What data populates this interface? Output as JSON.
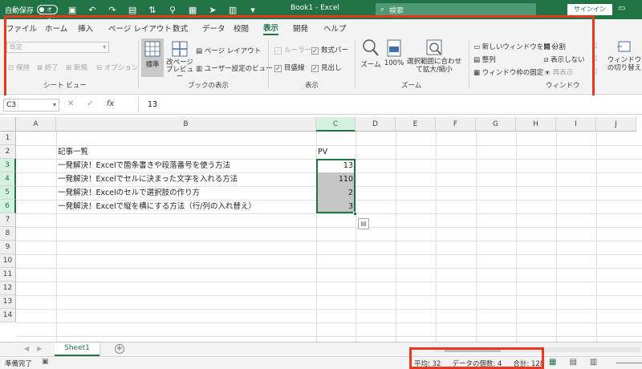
{
  "titlebar": {
    "autosave_label": "自動保存",
    "autosave_state": "オフ",
    "title": "Book1  -  Excel",
    "search_placeholder": "検索",
    "signin": "サインイン"
  },
  "tabs": [
    "ファイル",
    "ホーム",
    "挿入",
    "ページ レイアウト",
    "数式",
    "データ",
    "校閲",
    "表示",
    "開発",
    "ヘルプ"
  ],
  "active_tab": "表示",
  "ribbon": {
    "sheetview": {
      "dropdown": "既定",
      "keep": "保持",
      "exit": "終了",
      "new": "新規",
      "options": "オプション",
      "label": "シート ビュー"
    },
    "bookview": {
      "normal": "標準",
      "pagebreak": "改ページ プレビュー",
      "pagelayout": "ページ レイアウト",
      "custom": "ユーザー設定のビュー",
      "label": "ブックの表示"
    },
    "show": {
      "ruler": "ルーラー",
      "formulabar": "数式バー",
      "gridlines": "目盛線",
      "headings": "見出し",
      "label": "表示"
    },
    "zoom": {
      "zoom": "ズーム",
      "hundred": "100%",
      "fitsel": "選択範囲に合わせて拡大/縮小",
      "label": "ズーム"
    },
    "window": {
      "newwindow": "新しいウィンドウを開く",
      "arrange": "整列",
      "freeze": "ウィンドウ枠の固定",
      "split": "分割",
      "hide": "表示しない",
      "unhide": "再表示",
      "switch": "ウィンドウの切り替え",
      "label": "ウィンドウ"
    }
  },
  "formula_bar": {
    "name_box": "C3",
    "cancel": "✕",
    "enter": "✓",
    "fx": "fx",
    "value": "13"
  },
  "grid": {
    "columns": [
      "A",
      "B",
      "C",
      "D",
      "E",
      "F",
      "G",
      "H",
      "I",
      "J"
    ],
    "rows": [
      "1",
      "2",
      "3",
      "4",
      "5",
      "6",
      "7",
      "8",
      "9",
      "10",
      "11",
      "12",
      "13",
      "14"
    ],
    "header_b": "記事一覧",
    "header_c": "PV",
    "entries": [
      {
        "title": "一発解決！Excelで箇条書きや段落番号を使う方法",
        "pv": "13"
      },
      {
        "title": "一発解決！Excelでセルに決まった文字を入れる方法",
        "pv": "110"
      },
      {
        "title": "一発解決！Excelのセルで選択肢の作り方",
        "pv": "2"
      },
      {
        "title": "一発解決！Excelで縦を横にする方法（行/列の入れ替え）",
        "pv": "3"
      }
    ]
  },
  "sheets": [
    "Sheet1"
  ],
  "statusbar": {
    "ready": "準備完了",
    "average": "平均: 32",
    "count": "データの個数: 4",
    "sum": "合計: 128"
  },
  "colors": {
    "brand": "#217346",
    "highlight": "#e8381f"
  }
}
